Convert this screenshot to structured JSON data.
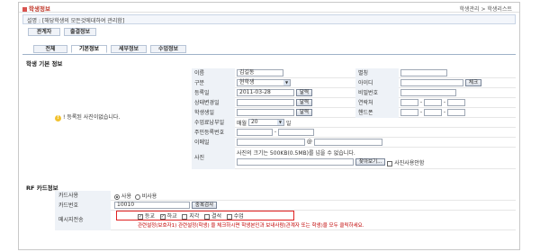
{
  "app_title": "학생정보",
  "breadcrumb": "학생관리 > 학생리스트",
  "description": "설명 : [해당학생의 모든것에대하여 관리함]",
  "buttons": {
    "manage": "관계자",
    "attendance": "출결정보"
  },
  "tabs": [
    "전체",
    "기본정보",
    "세부정보",
    "수업정보"
  ],
  "basic_section_title": "학생 기본 정보",
  "photo_note": "! 등록된 사진이없습니다.",
  "fields": {
    "name": {
      "label": "이름",
      "value": "김길동"
    },
    "gender": {
      "label": "별칭"
    },
    "type": {
      "label": "구분",
      "value": "현학생"
    },
    "id": {
      "label": "아이디",
      "check": "체크"
    },
    "reg_date": {
      "label": "등록일",
      "value": "2011-03-28",
      "btn": "달력"
    },
    "password": {
      "label": "비밀번호"
    },
    "consult_date": {
      "label": "상태변경일",
      "btn": "달력"
    },
    "contact": {
      "label": "연락처"
    },
    "birth": {
      "label": "학생생일",
      "btn": "달력"
    },
    "mobile": {
      "label": "핸드폰"
    },
    "fee_day": {
      "label": "수업료납부일",
      "prefix": "매월",
      "value": "20",
      "suffix": "일"
    },
    "ssn": {
      "label": "주민등록번호"
    },
    "email": {
      "label": "이메일",
      "at": "@"
    },
    "photo": {
      "label": "사진",
      "note": "사진의 크기는 500KB(0.5MB)를 넘을 수 없습니다.",
      "browse": "찾아보기...",
      "delete_label": "사진사용안함"
    }
  },
  "rf_section_title": "RF 카드정보",
  "rf": {
    "card_use": {
      "label": "카드사용",
      "use": "사용",
      "not_use": "비사용"
    },
    "card_no": {
      "label": "카드번호",
      "value": "10010",
      "btn": "중복검사"
    },
    "message": {
      "label": "메시지전송",
      "options": [
        "등교",
        "하교",
        "지각",
        "결석",
        "수업"
      ]
    },
    "hint": "관련설정(보호자1) 관련설정(학생) 을 체크하시면 학생본인과 보내사람(관계자 또는 학생)을 모두 클릭하세요."
  },
  "colors": {
    "title_red": "#c0392b",
    "highlight_red": "#e02020",
    "label_bg": "#eef2f7"
  }
}
